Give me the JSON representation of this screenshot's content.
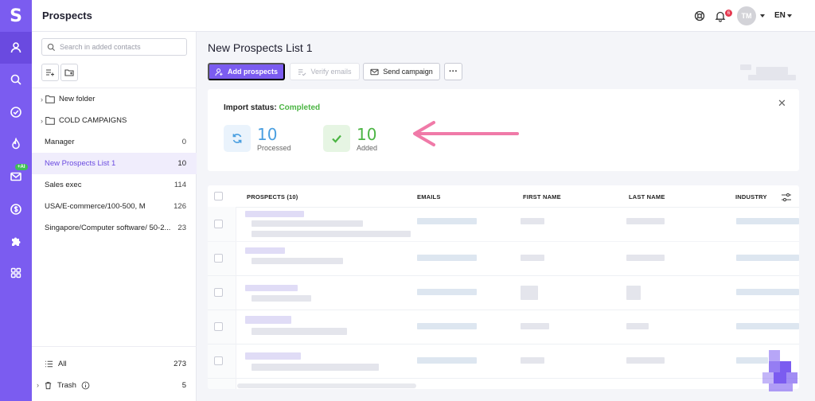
{
  "app": {
    "logo_letter": "S",
    "title": "Prospects",
    "accent": "#7b5cf0",
    "rail_icons": [
      "user-icon",
      "search-icon",
      "check-circle-icon",
      "flame-icon",
      "mail-icon",
      "dollar-icon",
      "puzzle-icon",
      "grid-icon"
    ],
    "ai_badge": "+AI"
  },
  "topbar": {
    "notification_count": "6",
    "avatar_initials": "TM",
    "language": "EN"
  },
  "sidebar": {
    "search_placeholder": "Search in added contacts",
    "folders": [
      {
        "label": "New folder"
      },
      {
        "label": "COLD CAMPAIGNS"
      }
    ],
    "lists": [
      {
        "label": "Manager",
        "count": "0"
      },
      {
        "label": "New Prospects List 1",
        "count": "10",
        "active": true
      },
      {
        "label": "Sales exec",
        "count": "114"
      },
      {
        "label": "USA/E-commerce/100-500, M",
        "count": "126"
      },
      {
        "label": "Singapore/Computer software/ 50-2...",
        "count": "23"
      }
    ],
    "all_label": "All",
    "all_count": "273",
    "trash_label": "Trash",
    "trash_count": "5"
  },
  "main": {
    "title": "New Prospects List 1",
    "buttons": {
      "add": "Add prospects",
      "verify": "Verify emails",
      "send": "Send campaign",
      "more": "···"
    },
    "import": {
      "label": "Import status:",
      "status": "Completed",
      "processed_value": "10",
      "processed_label": "Processed",
      "added_value": "10",
      "added_label": "Added",
      "processed_color": "#4a9fe0",
      "added_color": "#4cb544"
    },
    "table": {
      "headers": [
        "PROSPECTS (10)",
        "EMAILS",
        "FIRST NAME",
        "LAST NAME",
        "INDUSTRY"
      ]
    }
  }
}
